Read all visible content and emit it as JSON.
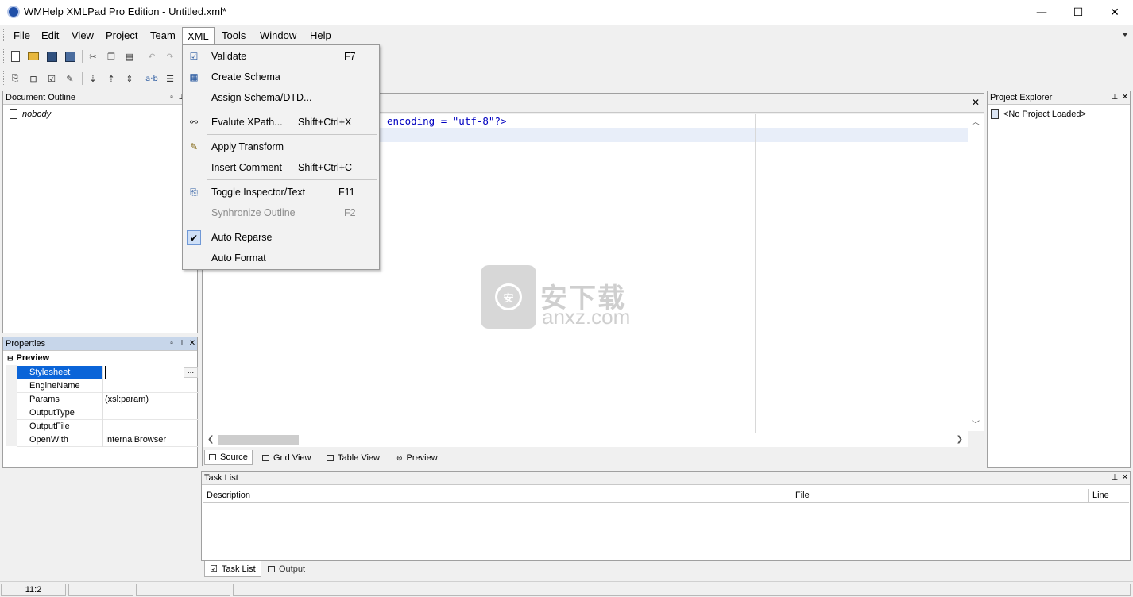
{
  "window": {
    "title": "WMHelp XMLPad Pro Edition - Untitled.xml*",
    "minimize_glyph": "—",
    "maximize_glyph": "☐",
    "close_glyph": "✕"
  },
  "menubar": {
    "items": [
      "File",
      "Edit",
      "View",
      "Project",
      "Team",
      "XML",
      "Tools",
      "Window",
      "Help"
    ]
  },
  "xml_menu": {
    "items": [
      {
        "label": "Validate",
        "shortcut": "F7",
        "icon": "validate-icon"
      },
      {
        "label": "Create Schema",
        "shortcut": "",
        "icon": "schema-icon"
      },
      {
        "label": "Assign Schema/DTD...",
        "shortcut": "",
        "icon": ""
      },
      {
        "label": "Evalute XPath...",
        "shortcut": "Shift+Ctrl+X",
        "icon": "glasses-icon"
      },
      {
        "label": "Apply Transform",
        "shortcut": "",
        "icon": "transform-icon"
      },
      {
        "label": "Insert Comment",
        "shortcut": "Shift+Ctrl+C",
        "icon": ""
      },
      {
        "label": "Toggle Inspector/Text",
        "shortcut": "F11",
        "icon": "inspector-icon"
      },
      {
        "label": "Synhronize Outline",
        "shortcut": "F2",
        "icon": "",
        "disabled": true
      },
      {
        "label": "Auto Reparse",
        "shortcut": "",
        "icon": "check-icon",
        "checked": true
      },
      {
        "label": "Auto Format",
        "shortcut": "",
        "icon": ""
      }
    ]
  },
  "document_outline": {
    "title": "Document Outline",
    "root_item": "nobody"
  },
  "properties": {
    "title": "Properties",
    "category": "Preview",
    "rows": [
      {
        "name": "Stylesheet",
        "value": ""
      },
      {
        "name": "EngineName",
        "value": ""
      },
      {
        "name": "Params",
        "value": "(xsl:param)"
      },
      {
        "name": "OutputType",
        "value": ""
      },
      {
        "name": "OutputFile",
        "value": ""
      },
      {
        "name": "OpenWith",
        "value": "InternalBrowser"
      }
    ],
    "ellipsis": "..."
  },
  "editor": {
    "code_line": "encoding = \"utf-8\"?>",
    "tabs": [
      "Source",
      "Grid View",
      "Table View",
      "Preview"
    ]
  },
  "project_explorer": {
    "title": "Project Explorer",
    "item": "<No Project Loaded>"
  },
  "task_list": {
    "title": "Task List",
    "columns": [
      "Description",
      "File",
      "Line"
    ]
  },
  "bottom_tabs": [
    "Task List",
    "Output"
  ],
  "statusbar": {
    "position": "11:2"
  },
  "watermark": {
    "brand_cn": "安下载",
    "brand_domain": "anxz.com",
    "shield_char": "安"
  }
}
